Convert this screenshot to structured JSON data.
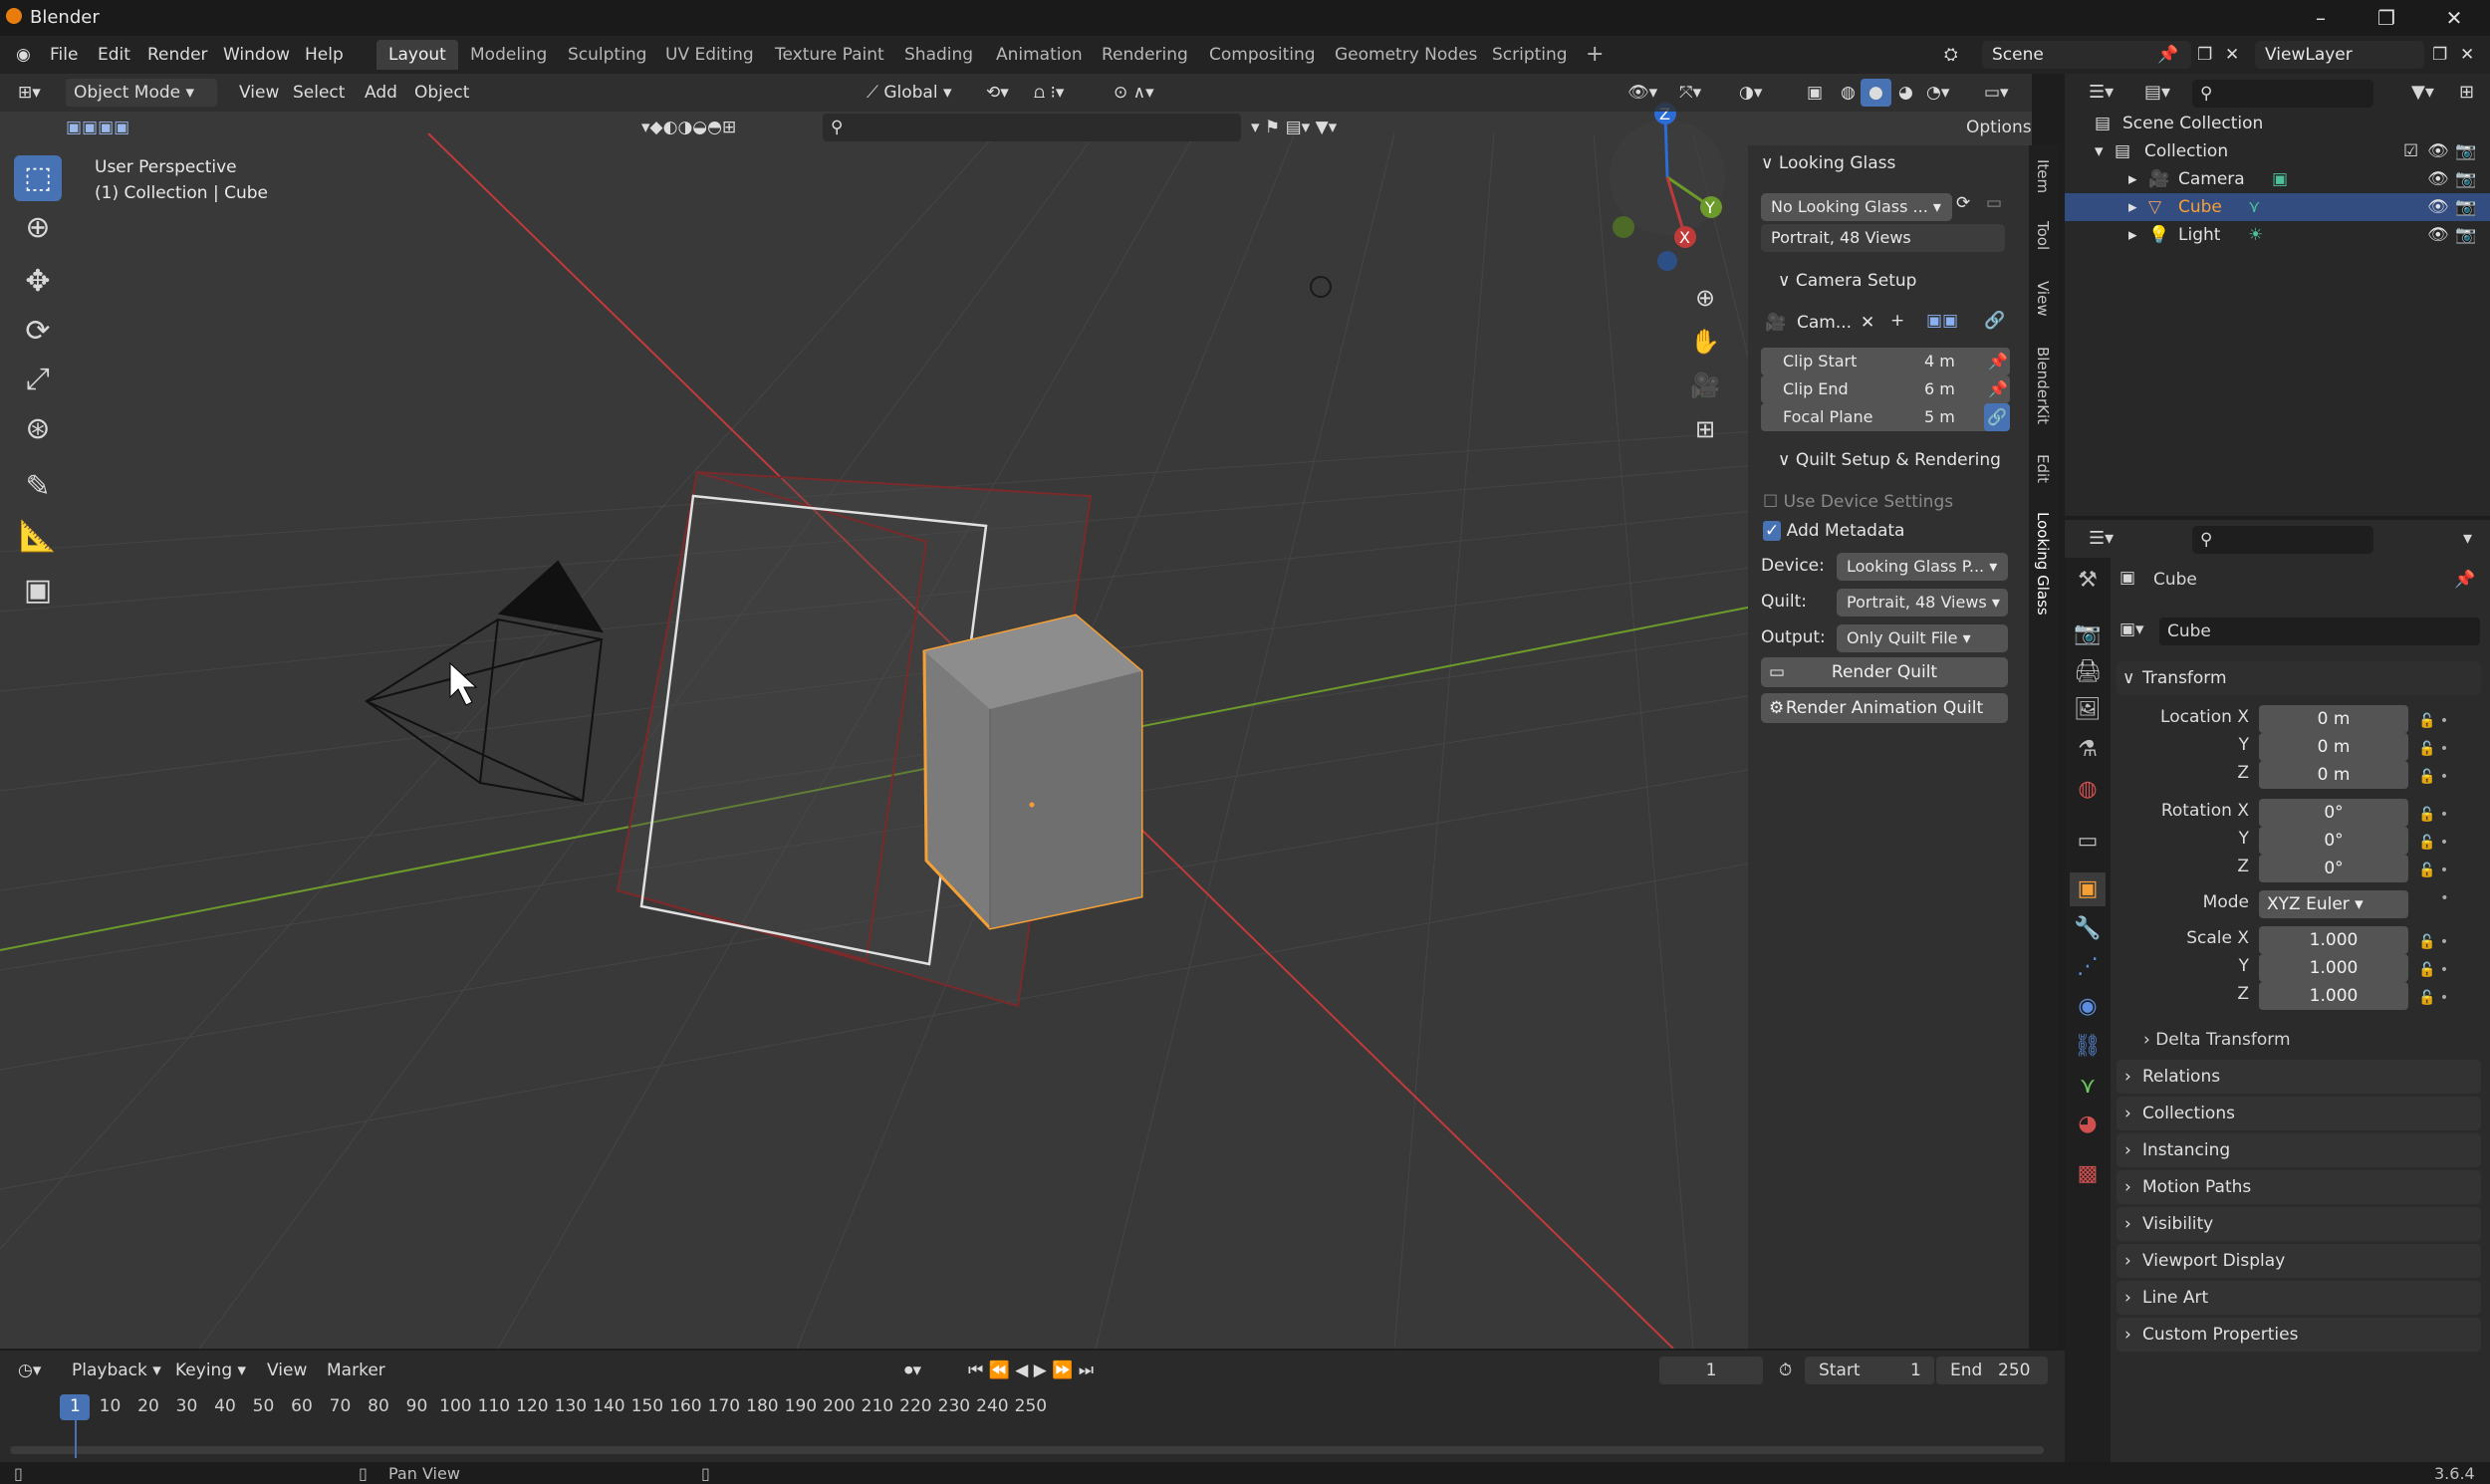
{
  "titlebar": {
    "title": "Blender"
  },
  "menu": [
    "File",
    "Edit",
    "Render",
    "Window",
    "Help"
  ],
  "workspaces": [
    "Layout",
    "Modeling",
    "Sculpting",
    "UV Editing",
    "Texture Paint",
    "Shading",
    "Animation",
    "Rendering",
    "Compositing",
    "Geometry Nodes",
    "Scripting"
  ],
  "active_workspace": "Layout",
  "scene_field": "Scene",
  "viewlayer_field": "ViewLayer",
  "viewport_header": {
    "mode": "Object Mode",
    "view": "View",
    "select": "Select",
    "add": "Add",
    "object": "Object",
    "orientation": "Global",
    "options": "Options"
  },
  "viewport_overlay": {
    "perspective": "User Perspective",
    "collection": "(1) Collection | Cube"
  },
  "looking_glass": {
    "title": "Looking Glass",
    "display": "No Looking Glass ...",
    "preset_dim": "Portrait, 48 Views",
    "camera_setup": "Camera Setup",
    "camera_name": "Cam...",
    "clip_start_label": "Clip Start",
    "clip_start_value": "4 m",
    "clip_end_label": "Clip End",
    "clip_end_value": "6 m",
    "focal_label": "Focal Plane",
    "focal_value": "5 m",
    "quilt_setup": "Quilt Setup & Rendering",
    "use_device": "Use Device Settings",
    "add_metadata": "Add Metadata",
    "device_label": "Device:",
    "device_value": "Looking Glass P...",
    "quilt_label": "Quilt:",
    "quilt_value": "Portrait, 48 Views",
    "output_label": "Output:",
    "output_value": "Only Quilt File",
    "render_quilt": "Render Quilt",
    "render_anim": "Render Animation Quilt"
  },
  "vertical_tabs": [
    "Item",
    "Tool",
    "View",
    "BlenderKit",
    "Edit",
    "Looking Glass"
  ],
  "outliner": {
    "scene_collection": "Scene Collection",
    "collection": "Collection",
    "items": [
      "Camera",
      "Cube",
      "Light"
    ]
  },
  "properties": {
    "object_name": "Cube",
    "data_name": "Cube",
    "transform": "Transform",
    "location_x_label": "Location X",
    "y_label": "Y",
    "z_label": "Z",
    "rotation_x_label": "Rotation X",
    "mode_label": "Mode",
    "scale_x_label": "Scale X",
    "location": [
      "0 m",
      "0 m",
      "0 m"
    ],
    "rotation": [
      "0°",
      "0°",
      "0°"
    ],
    "mode_value": "XYZ Euler",
    "scale": [
      "1.000",
      "1.000",
      "1.000"
    ],
    "sections": [
      "Delta Transform",
      "Relations",
      "Collections",
      "Instancing",
      "Motion Paths",
      "Visibility",
      "Viewport Display",
      "Line Art",
      "Custom Properties"
    ]
  },
  "timeline": {
    "playback": "Playback",
    "keying": "Keying",
    "view": "View",
    "marker": "Marker",
    "current_frame": "1",
    "start_label": "Start",
    "start_value": "1",
    "end_label": "End",
    "end_value": "250",
    "ruler": [
      "1",
      "10",
      "20",
      "30",
      "40",
      "50",
      "60",
      "70",
      "80",
      "90",
      "100",
      "110",
      "120",
      "130",
      "140",
      "150",
      "160",
      "170",
      "180",
      "190",
      "200",
      "210",
      "220",
      "230",
      "240",
      "250"
    ]
  },
  "statusbar": {
    "hint": "Pan View",
    "version": "3.6.4"
  },
  "colors": {
    "accent": "#4772b3",
    "selection_orange": "#f5a035",
    "x_axis": "#c13a3a",
    "y_axis": "#6c9a2b"
  }
}
